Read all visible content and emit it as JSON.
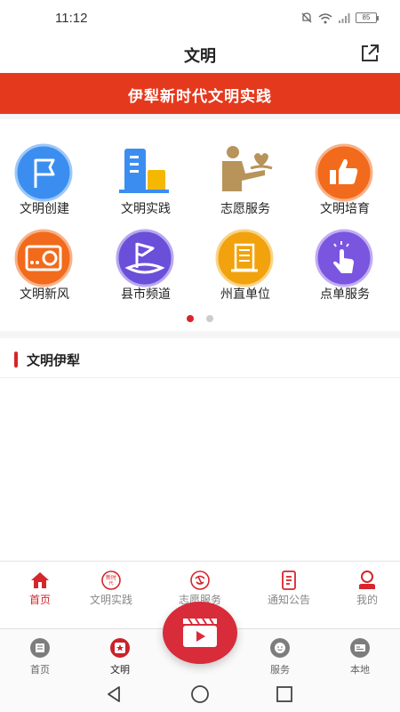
{
  "status_bar": {
    "time": "11:12",
    "battery": "85"
  },
  "header": {
    "title": "文明"
  },
  "banner": {
    "text": "伊犁新时代文明实践"
  },
  "grid": {
    "items": [
      {
        "label": "文明创建",
        "icon": "flag-icon",
        "color": "#3b8ef0"
      },
      {
        "label": "文明实践",
        "icon": "buildings-icon",
        "color": "#3b8ef0"
      },
      {
        "label": "志愿服务",
        "icon": "volunteer-icon",
        "color": "#b8935a"
      },
      {
        "label": "文明培育",
        "icon": "thumbs-up-icon",
        "color": "#f26a1b"
      },
      {
        "label": "文明新风",
        "icon": "radio-icon",
        "color": "#f26a1b"
      },
      {
        "label": "县市频道",
        "icon": "map-flag-icon",
        "color": "#6a4fd8"
      },
      {
        "label": "州直单位",
        "icon": "office-building-icon",
        "color": "#f2a20c"
      },
      {
        "label": "点单服务",
        "icon": "tap-hand-icon",
        "color": "#7a55e0"
      }
    ],
    "pages": 2,
    "active_page": 1
  },
  "section": {
    "title": "文明伊犁"
  },
  "inner_nav": {
    "items": [
      {
        "label": "首页",
        "icon": "home-icon",
        "active": true
      },
      {
        "label": "文明实践",
        "icon": "new-era-badge-icon",
        "active": false
      },
      {
        "label": "志愿服务",
        "icon": "volunteer-badge-icon",
        "active": false
      },
      {
        "label": "通知公告",
        "icon": "notice-icon",
        "active": false
      },
      {
        "label": "我的",
        "icon": "user-icon",
        "active": false
      }
    ]
  },
  "outer_nav": {
    "items": [
      {
        "label": "首页",
        "icon": "news-icon"
      },
      {
        "label": "文明",
        "icon": "star-badge-icon"
      },
      {
        "label": "服务",
        "icon": "smile-icon"
      },
      {
        "label": "本地",
        "icon": "local-card-icon"
      }
    ]
  },
  "colors": {
    "accent": "#d6262b",
    "banner": "#e5391e",
    "fab": "#d82c3a"
  }
}
